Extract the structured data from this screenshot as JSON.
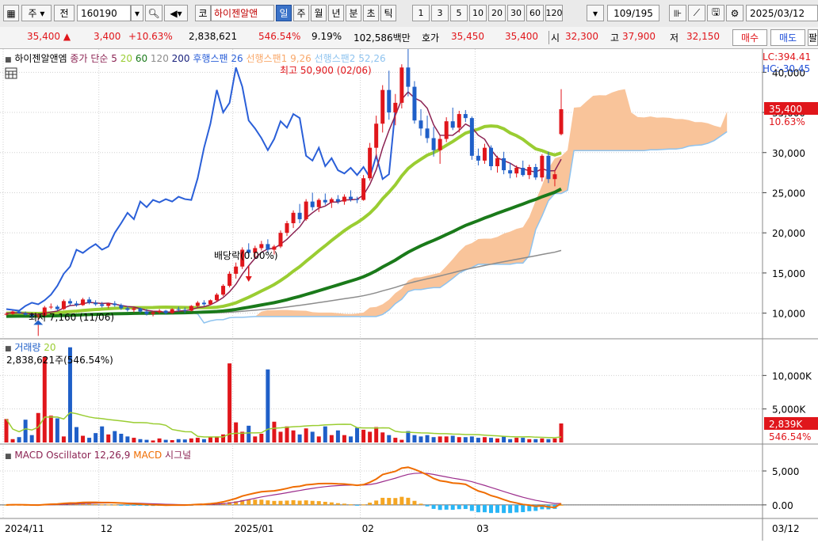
{
  "toolbar": {
    "market": "주",
    "type_label": "전",
    "code": "160190",
    "market2": "코",
    "stock_name": "하이젠알앤",
    "periods": [
      "일",
      "주",
      "월",
      "년",
      "분",
      "초",
      "틱"
    ],
    "selected_period": "일",
    "intervals": [
      "1",
      "3",
      "5",
      "10",
      "20",
      "30",
      "60",
      "120"
    ],
    "page_count": "109/195",
    "date": "2025/03/12"
  },
  "quote": {
    "price": "35,400",
    "change": "3,400",
    "change_pct": "+10.63%",
    "volume": "2,838,621",
    "volume_ratio": "546.54%",
    "turnover": "9.19%",
    "amount": "102,586백만",
    "bid_label": "호가",
    "ask_price": "35,450",
    "bid_price": "35,400",
    "open_label": "시",
    "open": "32,300",
    "high_label": "고",
    "high": "37,900",
    "low_label": "저",
    "low": "32,150",
    "buy_label": "매수",
    "sell_label": "매도",
    "extra_label": "팔"
  },
  "price_legend": {
    "name": "하이젠알앤엠",
    "ma_label": "종가 단순",
    "ma_periods": [
      "5",
      "20",
      "60",
      "120",
      "200"
    ],
    "lagging": "후행스팬 26",
    "leading1": "선행스팬1 9,26",
    "leading2": "선행스팬2 52,26",
    "lc": "LC:394.41",
    "hc": "HC:-30.45"
  },
  "annotations": {
    "high": "최고 50,900 (02/06)",
    "low": "최저 7,160 (11/06)",
    "dividend": "배당락(0.00%)"
  },
  "price_axis": {
    "ticks": [
      "40,000",
      "35,000",
      "30,000",
      "25,000",
      "20,000",
      "15,000",
      "10,000"
    ],
    "current": "35,400",
    "current_pct": "10.63%"
  },
  "volume_legend": {
    "title": "거래량",
    "ma": "20",
    "value": "2,838,621주(546.54%)"
  },
  "volume_axis": {
    "ticks": [
      "10,000K",
      "5,000K"
    ],
    "current": "2,839K",
    "current_pct": "546.54%"
  },
  "macd_legend": {
    "osc": "MACD Oscillator 12,26,9",
    "macd": "MACD",
    "signal": "시그널"
  },
  "macd_axis": {
    "ticks": [
      "5,000",
      "0.00"
    ]
  },
  "x_axis": {
    "labels": [
      "2024/11",
      "12",
      "2025/01",
      "02",
      "03"
    ],
    "right": "03/12"
  },
  "colors": {
    "up": "#e0161b",
    "down": "#1f5fc8",
    "ma5": "#8b2252",
    "ma20": "#9acd32",
    "ma60": "#1a7a1a",
    "ma120": "#8c8c8c",
    "lagging": "#2a5fd8",
    "cloud": "#f9c49a"
  },
  "chart_data": {
    "type": "candlestick",
    "ylim": [
      7000,
      42500
    ],
    "candles": [
      [
        9800,
        10100,
        9700,
        9900
      ],
      [
        9900,
        10300,
        9800,
        10200
      ],
      [
        10200,
        10400,
        9900,
        10000
      ],
      [
        10000,
        10200,
        9700,
        9800
      ],
      [
        9800,
        10000,
        9400,
        9600
      ],
      [
        9600,
        9900,
        7160,
        9700
      ],
      [
        9700,
        10900,
        9600,
        10700
      ],
      [
        10700,
        11200,
        10500,
        10800
      ],
      [
        10800,
        11000,
        10300,
        10500
      ],
      [
        10500,
        11700,
        10400,
        11500
      ],
      [
        11500,
        11800,
        11000,
        11200
      ],
      [
        11200,
        11500,
        10800,
        11000
      ],
      [
        11000,
        11900,
        10900,
        11700
      ],
      [
        11700,
        12000,
        11100,
        11300
      ],
      [
        11300,
        11600,
        10900,
        11100
      ],
      [
        11100,
        11400,
        10700,
        10900
      ],
      [
        10900,
        11300,
        10600,
        11200
      ],
      [
        11200,
        11500,
        10800,
        11000
      ],
      [
        11000,
        11200,
        10400,
        10600
      ],
      [
        10600,
        10900,
        10200,
        10400
      ],
      [
        10400,
        10800,
        10100,
        10600
      ],
      [
        10600,
        10700,
        10000,
        10200
      ],
      [
        10200,
        10500,
        9700,
        9900
      ],
      [
        9900,
        10300,
        9600,
        10100
      ],
      [
        10100,
        10500,
        9900,
        10300
      ],
      [
        10300,
        10400,
        9800,
        10000
      ],
      [
        10000,
        10600,
        9900,
        10500
      ],
      [
        10500,
        10800,
        10200,
        10400
      ],
      [
        10400,
        10700,
        10000,
        10300
      ],
      [
        10300,
        11000,
        10200,
        10900
      ],
      [
        10900,
        11500,
        10700,
        11300
      ],
      [
        11300,
        11600,
        10900,
        11100
      ],
      [
        11100,
        11700,
        11000,
        11600
      ],
      [
        11600,
        12500,
        11400,
        12300
      ],
      [
        12300,
        13600,
        12100,
        13400
      ],
      [
        13400,
        15200,
        13200,
        14900
      ],
      [
        14900,
        16300,
        14300,
        15800
      ],
      [
        15800,
        18200,
        15500,
        17900
      ],
      [
        17900,
        18700,
        17000,
        17500
      ],
      [
        17500,
        18400,
        16900,
        18100
      ],
      [
        18100,
        19000,
        17800,
        18600
      ],
      [
        18600,
        19200,
        17500,
        17900
      ],
      [
        17900,
        18500,
        17300,
        18300
      ],
      [
        18300,
        20300,
        18100,
        20000
      ],
      [
        20000,
        21500,
        19600,
        21200
      ],
      [
        21200,
        22800,
        20600,
        22500
      ],
      [
        22500,
        23600,
        21200,
        21700
      ],
      [
        21700,
        24200,
        21500,
        23900
      ],
      [
        23900,
        25000,
        22800,
        23200
      ],
      [
        23200,
        24300,
        22600,
        24100
      ],
      [
        24100,
        24900,
        23500,
        23800
      ],
      [
        23800,
        24400,
        23100,
        24200
      ],
      [
        24200,
        24700,
        23600,
        23900
      ],
      [
        23900,
        24800,
        23500,
        24500
      ],
      [
        24500,
        25300,
        23900,
        24200
      ],
      [
        24200,
        24500,
        23700,
        24100
      ],
      [
        24100,
        27200,
        24000,
        26800
      ],
      [
        26800,
        31200,
        26500,
        30600
      ],
      [
        30600,
        34600,
        29200,
        33600
      ],
      [
        33600,
        38400,
        32500,
        37800
      ],
      [
        37800,
        40200,
        34100,
        35000
      ],
      [
        35000,
        37300,
        33400,
        36200
      ],
      [
        36200,
        41000,
        35500,
        40600
      ],
      [
        40600,
        50900,
        37000,
        38200
      ],
      [
        38200,
        38900,
        33600,
        34000
      ],
      [
        34000,
        35400,
        32100,
        33000
      ],
      [
        33000,
        34600,
        31200,
        31800
      ],
      [
        31800,
        33200,
        29500,
        30300
      ],
      [
        30300,
        32100,
        28600,
        31700
      ],
      [
        31700,
        34400,
        31300,
        33900
      ],
      [
        33900,
        35600,
        32800,
        33100
      ],
      [
        33100,
        35200,
        32500,
        34800
      ],
      [
        34800,
        35300,
        33800,
        34300
      ],
      [
        34300,
        34500,
        29100,
        29600
      ],
      [
        29600,
        30500,
        28400,
        29000
      ],
      [
        29000,
        31100,
        28600,
        30600
      ],
      [
        30600,
        30900,
        27800,
        28300
      ],
      [
        28300,
        29600,
        27500,
        29300
      ],
      [
        29300,
        30100,
        27300,
        27800
      ],
      [
        27800,
        28700,
        26800,
        27400
      ],
      [
        27400,
        28400,
        26900,
        28100
      ],
      [
        28100,
        29000,
        27000,
        27200
      ],
      [
        27200,
        28500,
        26700,
        28200
      ],
      [
        28200,
        28600,
        26600,
        26900
      ],
      [
        26900,
        29800,
        26400,
        29600
      ],
      [
        29600,
        30100,
        26200,
        26700
      ],
      [
        26700,
        27800,
        25800,
        27300
      ],
      [
        32300,
        37900,
        32150,
        35400
      ]
    ],
    "volume_k": [
      3500,
      500,
      800,
      3400,
      1100,
      4400,
      12800,
      4000,
      3600,
      900,
      14200,
      2300,
      1000,
      700,
      1400,
      2400,
      1200,
      1700,
      1300,
      900,
      700,
      500,
      400,
      300,
      600,
      400,
      350,
      500,
      450,
      600,
      700,
      500,
      800,
      900,
      1200,
      11800,
      3000,
      1600,
      2500,
      900,
      1300,
      10900,
      3100,
      1600,
      2400,
      1800,
      1200,
      2100,
      1600,
      900,
      2400,
      1100,
      1800,
      1100,
      900,
      2200,
      1900,
      1600,
      2300,
      1500,
      1100,
      700,
      400,
      1700,
      1100,
      900,
      1100,
      800,
      900,
      900,
      1000,
      800,
      800,
      900,
      700,
      800,
      700,
      600,
      900,
      500,
      700,
      700,
      500,
      500,
      600,
      500,
      600,
      2839
    ],
    "macd": {
      "osc_note": "bars",
      "ylim": [
        -2000,
        8500
      ]
    }
  }
}
